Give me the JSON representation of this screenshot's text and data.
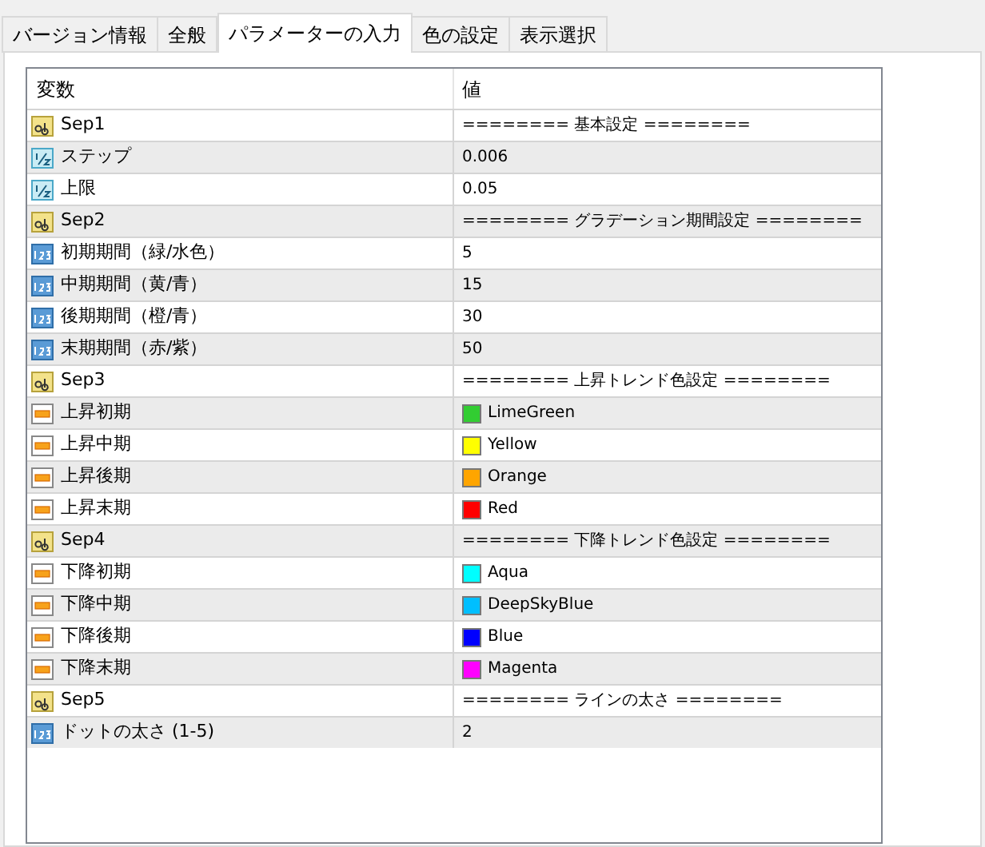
{
  "tabs": [
    {
      "label": "バージョン情報",
      "selected": false
    },
    {
      "label": "全般",
      "selected": false
    },
    {
      "label": "パラメーターの入力",
      "selected": true
    },
    {
      "label": "色の設定",
      "selected": false
    },
    {
      "label": "表示選択",
      "selected": false
    }
  ],
  "table": {
    "columns": [
      "変数",
      "値"
    ],
    "rows": [
      {
        "kind": "string",
        "name": "Sep1",
        "value": "======== 基本設定 ========"
      },
      {
        "kind": "double",
        "name": "ステップ",
        "value": "0.006"
      },
      {
        "kind": "double",
        "name": "上限",
        "value": "0.05"
      },
      {
        "kind": "string",
        "name": "Sep2",
        "value": "======== グラデーション期間設定 ========"
      },
      {
        "kind": "int",
        "name": "初期期間（緑/水色）",
        "value": "5"
      },
      {
        "kind": "int",
        "name": "中期期間（黄/青）",
        "value": "15"
      },
      {
        "kind": "int",
        "name": "後期期間（橙/青）",
        "value": "30"
      },
      {
        "kind": "int",
        "name": "末期期間（赤/紫）",
        "value": "50"
      },
      {
        "kind": "string",
        "name": "Sep3",
        "value": "======== 上昇トレンド色設定 ========"
      },
      {
        "kind": "color",
        "name": "上昇初期",
        "value": "LimeGreen",
        "color": "#32cd32"
      },
      {
        "kind": "color",
        "name": "上昇中期",
        "value": "Yellow",
        "color": "#ffff00"
      },
      {
        "kind": "color",
        "name": "上昇後期",
        "value": "Orange",
        "color": "#ffa500"
      },
      {
        "kind": "color",
        "name": "上昇末期",
        "value": "Red",
        "color": "#ff0000"
      },
      {
        "kind": "string",
        "name": "Sep4",
        "value": "======== 下降トレンド色設定 ========"
      },
      {
        "kind": "color",
        "name": "下降初期",
        "value": "Aqua",
        "color": "#00ffff"
      },
      {
        "kind": "color",
        "name": "下降中期",
        "value": "DeepSkyBlue",
        "color": "#00bfff"
      },
      {
        "kind": "color",
        "name": "下降後期",
        "value": "Blue",
        "color": "#0000ff"
      },
      {
        "kind": "color",
        "name": "下降末期",
        "value": "Magenta",
        "color": "#ff00ff"
      },
      {
        "kind": "string",
        "name": "Sep5",
        "value": "======== ラインの太さ ========"
      },
      {
        "kind": "int",
        "name": "ドットの太さ (1-5)",
        "value": "2"
      }
    ]
  }
}
